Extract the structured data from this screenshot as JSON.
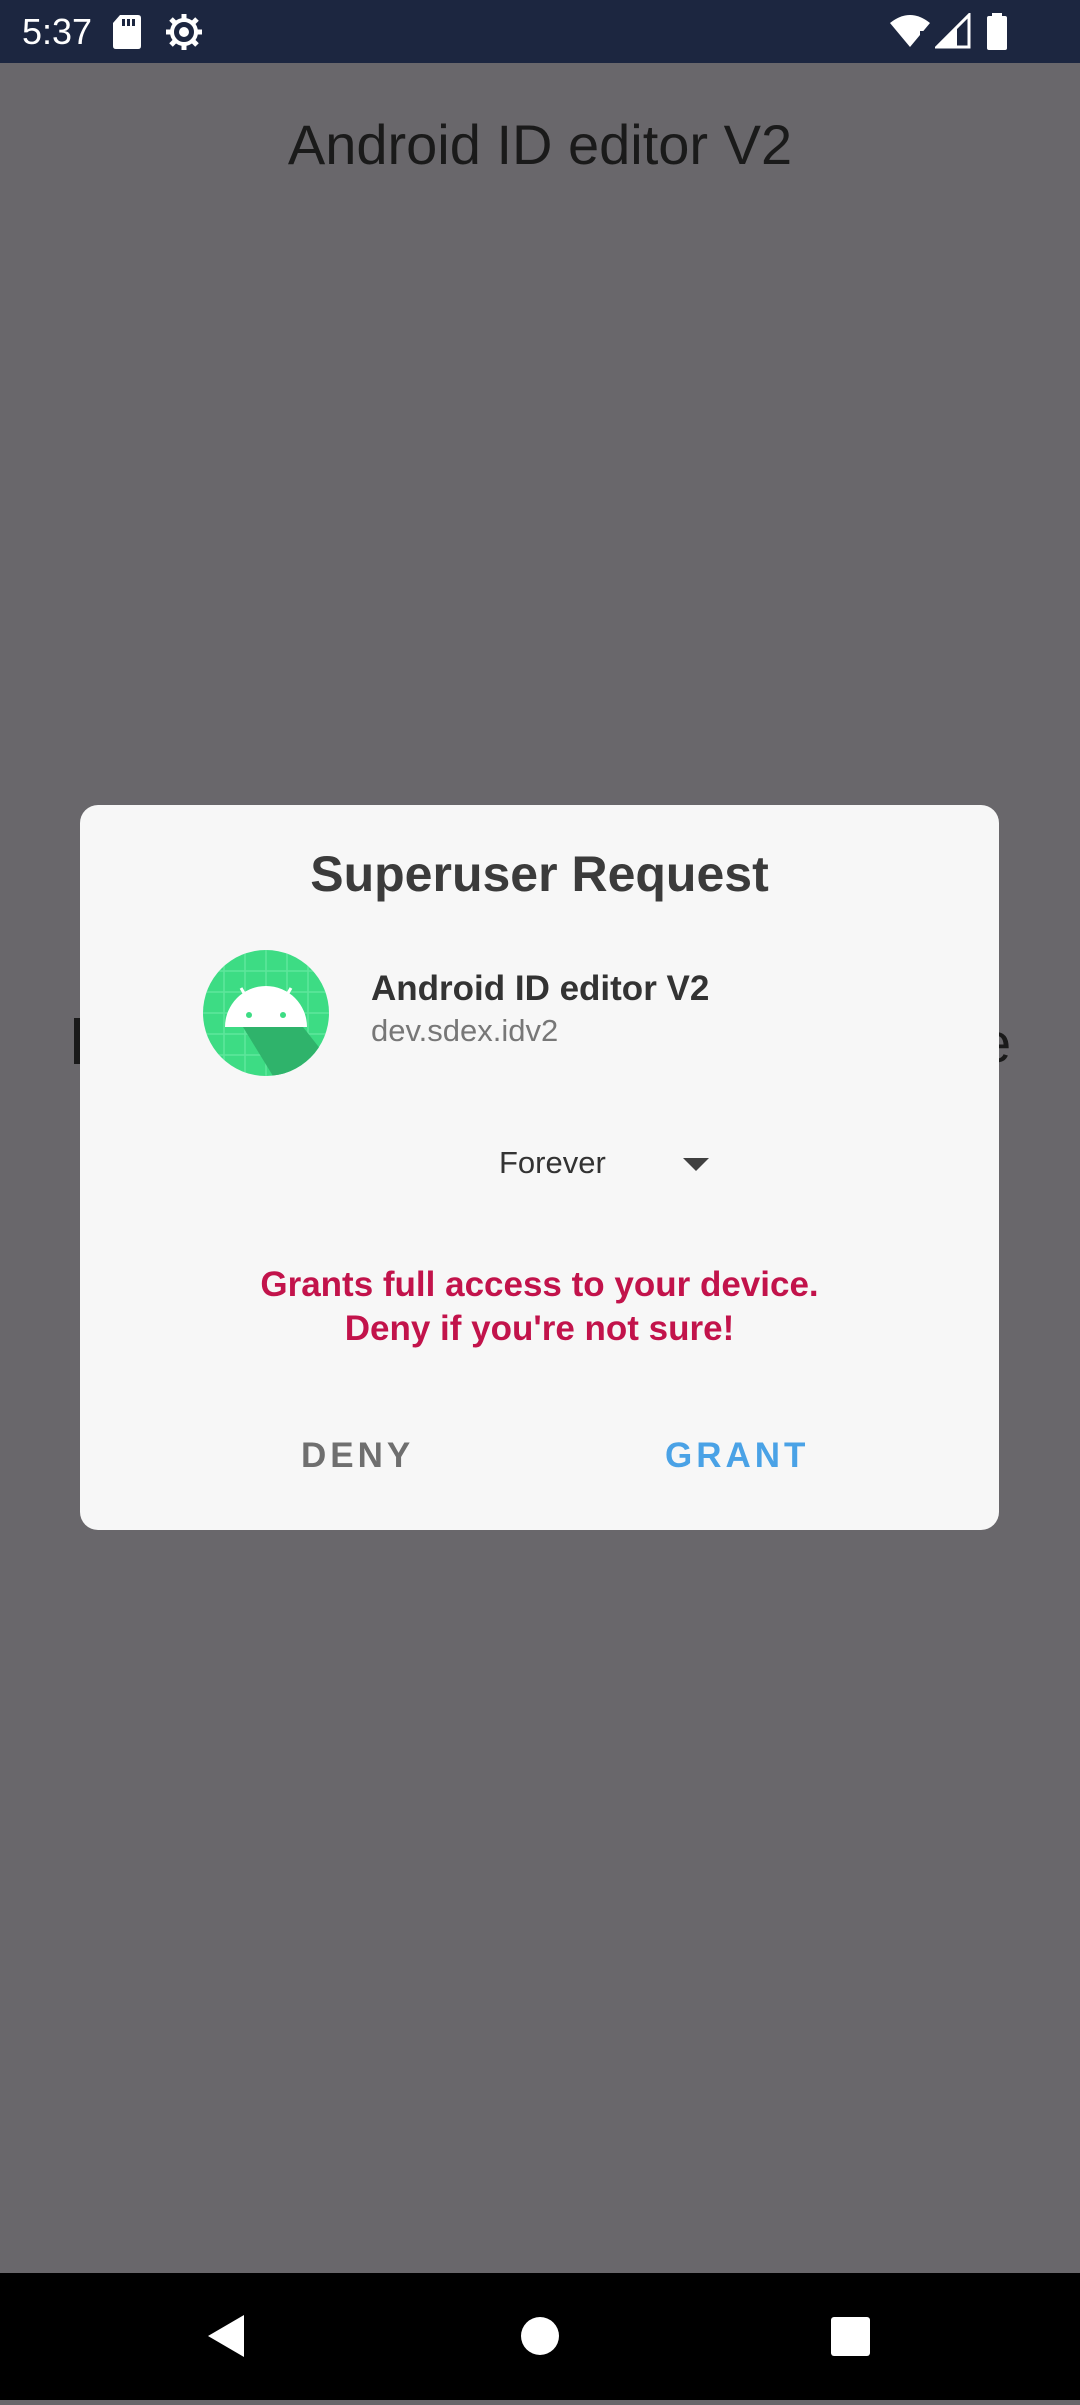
{
  "status_bar": {
    "time": "5:37",
    "icons": [
      "sd-card-icon",
      "settings-gear-icon",
      "wifi-icon",
      "signal-icon",
      "battery-icon"
    ]
  },
  "background_app": {
    "title": "Android ID editor V2",
    "right_fragment": "e"
  },
  "dialog": {
    "title": "Superuser Request",
    "app_name": "Android ID editor V2",
    "package_name": "dev.sdex.idv2",
    "duration": "Forever",
    "warning_line1": "Grants full access to your device.",
    "warning_line2": "Deny if you're not sure!",
    "deny_label": "DENY",
    "grant_label": "GRANT"
  },
  "colors": {
    "status_bar": "#1c2640",
    "scrim": "#69676b",
    "dialog_bg": "#f7f7f7",
    "warning": "#c2134b",
    "grant": "#4aa2e6",
    "deny": "#6f6f6f",
    "app_icon": "#3ddc84"
  },
  "nav_bar": {
    "icons": [
      "back-icon",
      "home-icon",
      "recents-icon"
    ]
  }
}
